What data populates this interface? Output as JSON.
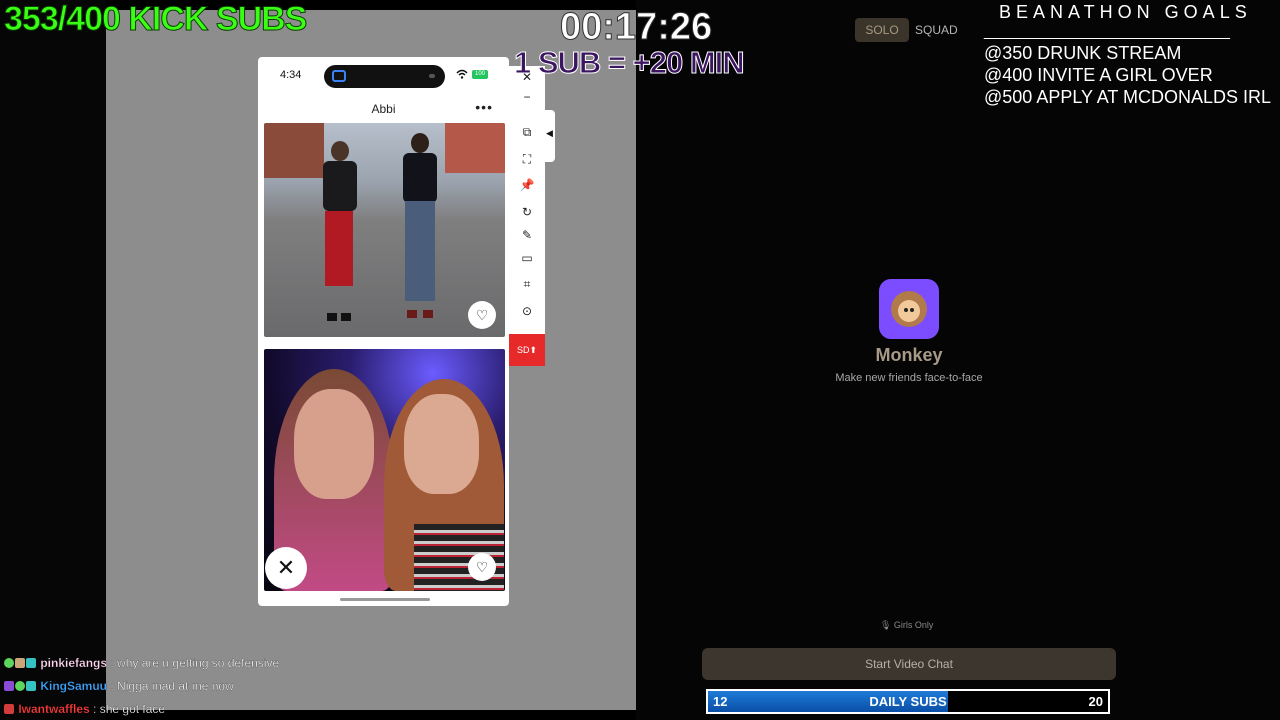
{
  "overlay": {
    "kick_subs": "353/400 KICK SUBS",
    "timer": "00:17:26",
    "sub_rule": "1 SUB = +20 MIN",
    "goals_title": "BEANATHON GOALS",
    "goals_rule": "_______________________________",
    "goals": [
      "@350 DRUNK  STREAM",
      "@400 INVITE A GIRL OVER",
      "@500 APPLY AT MCDONALDS IRL"
    ]
  },
  "phone": {
    "time": "4:34",
    "wifi_icon": "wifi-icon",
    "battery": "100",
    "profile_name": "Abbi",
    "more_label": "•••",
    "like_glyph": "♡",
    "pass_glyph": "✕"
  },
  "toolbar": {
    "icons": [
      "close-icon",
      "minimize-icon",
      "screenshot-icon",
      "fullscreen-icon",
      "pin-icon",
      "rotate-icon",
      "draw-icon",
      "window-icon",
      "crop-icon",
      "record-icon"
    ],
    "glyphs": [
      "✕",
      "−",
      "⧉",
      "⛶",
      "📌",
      "↻",
      "✎",
      "▭",
      "⌗",
      "⊙"
    ],
    "sd_label": "SD⬆",
    "collapse_glyph": "◀"
  },
  "monkey": {
    "mode_solo": "SOLO",
    "mode_squad": "SQUAD",
    "app_name": "Monkey",
    "tagline": "Make new friends face-to-face",
    "girls_only": "🎙 Girls Only",
    "start_button": "Start Video Chat",
    "brand_color": "#7c4dff"
  },
  "daily_subs": {
    "current": "12",
    "label": "DAILY SUBS",
    "goal": "20",
    "progress": 0.6
  },
  "chat": [
    {
      "user": "pinkiefangs",
      "message": ": why are u getting so defensive",
      "color": "#ffd6f0"
    },
    {
      "user": "KingSamuu",
      "message": ": Nigga mad at me now",
      "color": "#3ea6ff"
    },
    {
      "user": "Iwantwaffles",
      "message": ": she got face",
      "color": "#ff3b3b"
    }
  ]
}
